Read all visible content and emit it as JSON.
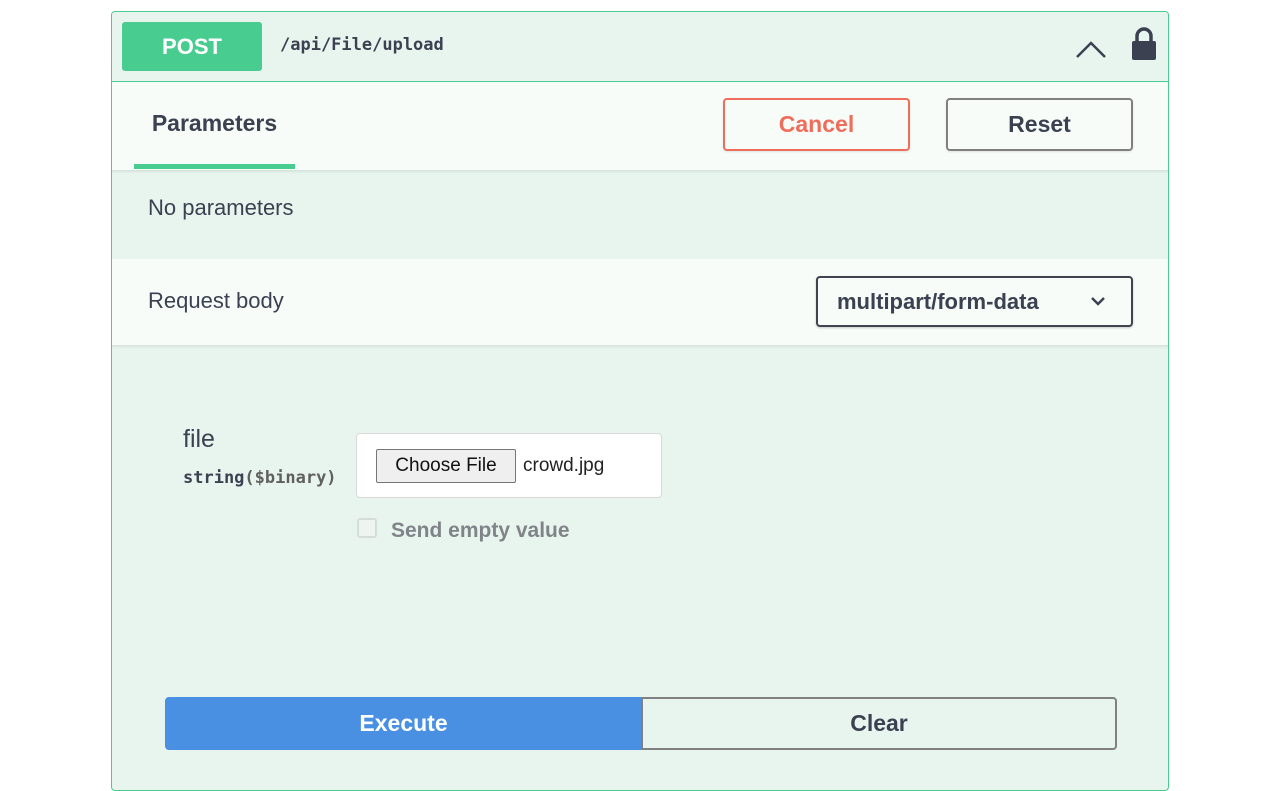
{
  "operation": {
    "method": "POST",
    "path": "/api/File/upload"
  },
  "tabs": {
    "parameters_label": "Parameters"
  },
  "actions": {
    "cancel_label": "Cancel",
    "reset_label": "Reset"
  },
  "parameters": {
    "empty_text": "No parameters"
  },
  "request_body": {
    "label": "Request body",
    "content_type": "multipart/form-data"
  },
  "body_param": {
    "name": "file",
    "type": "string",
    "format": "($binary)",
    "choose_button_label": "Choose File",
    "selected_file": "crowd.jpg",
    "send_empty_label": "Send empty value",
    "send_empty_checked": false
  },
  "execute": {
    "execute_label": "Execute",
    "clear_label": "Clear"
  },
  "colors": {
    "post_green": "#49cc90",
    "cancel_red": "#ef6e5b",
    "execute_blue": "#4990e2",
    "block_bg": "#e8f5ee"
  },
  "icons": {
    "collapse": "chevron-up-icon",
    "auth": "lock-icon",
    "select_arrow": "chevron-down-icon"
  }
}
